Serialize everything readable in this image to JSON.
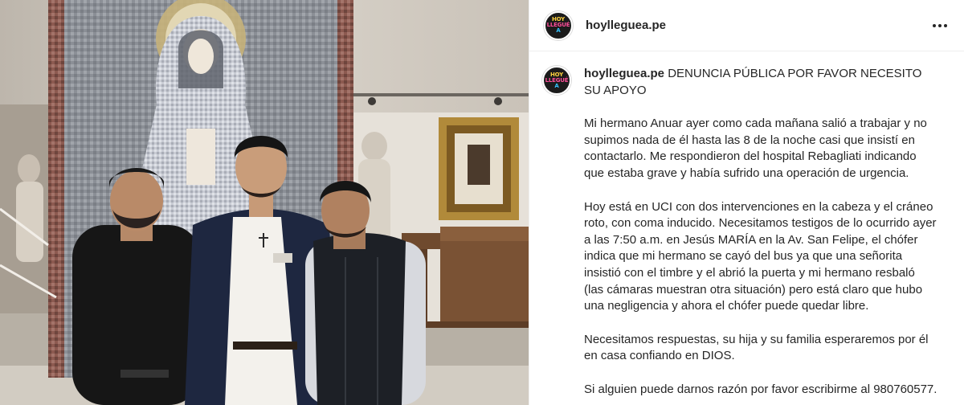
{
  "post": {
    "author": "hoylleguea.pe",
    "avatar_text": [
      "HOY",
      "LLEGUÉ",
      "A"
    ],
    "more_icon": "three-dots-horizontal-icon",
    "caption_title": "DENUNCIA PÚBLICA POR FAVOR NECESITO SU APOYO",
    "paragraphs": [
      "Mi hermano Anuar ayer como cada mañana salió a trabajar y no supimos nada de él hasta las 8 de la noche casi que insistí en contactarlo. Me respondieron del hospital Rebagliati indicando que estaba grave y había sufrido una operación de urgencia.",
      "Hoy está en UCI con dos intervenciones en la cabeza y el cráneo roto, con coma inducido. Necesitamos testigos de lo ocurrido ayer a las 7:50 a.m. en Jesús MARÍA en la Av. San Felipe, el chófer indica que mi hermano se cayó del bus ya que una señorita insistió con el timbre y el abrió la puerta y mi hermano resbaló (las cámaras muestran otra situación) pero está claro que hubo una negligencia y ahora el chófer puede quedar libre.",
      "Necesitamos respuestas, su hija y su familia esperaremos por él en casa confiando en DIOS.",
      "Si alguien puede darnos razón por favor escribirme al 980760577."
    ]
  },
  "colors": {
    "text": "#262626",
    "divider": "#efefef",
    "avatar_bg": "#1b1b1b"
  }
}
